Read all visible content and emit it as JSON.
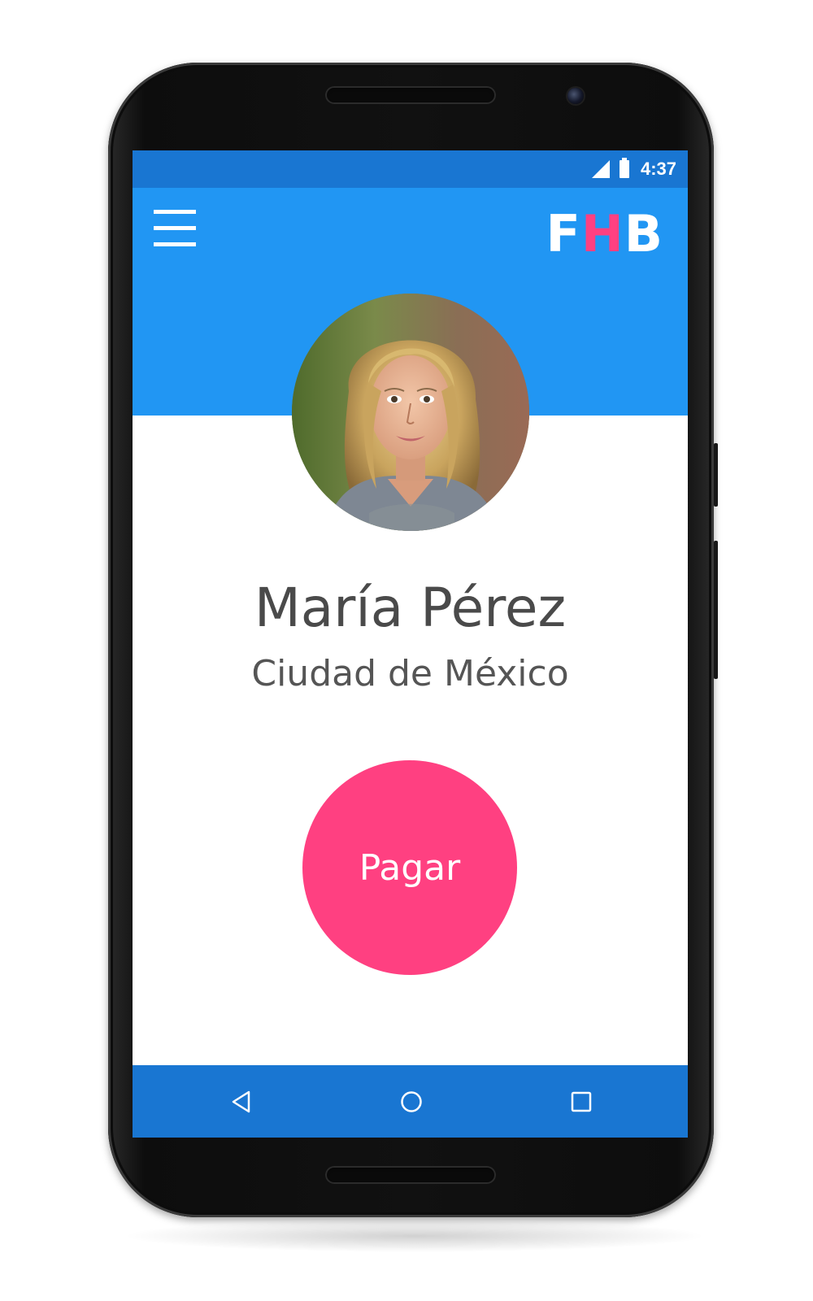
{
  "status_bar": {
    "time": "4:37",
    "icons": [
      "signal-icon",
      "battery-icon"
    ]
  },
  "app_bar": {
    "logo": {
      "f": "F",
      "h": "H",
      "b": "B"
    },
    "menu_icon": "hamburger-menu-icon"
  },
  "profile": {
    "name": "María Pérez",
    "city": "Ciudad de México"
  },
  "actions": {
    "pay_label": "Pagar"
  },
  "nav_bar": {
    "icons": [
      "back-icon",
      "home-icon",
      "recent-apps-icon"
    ]
  },
  "colors": {
    "primary": "#2196F3",
    "primary_dark": "#1976D2",
    "accent": "#FF4081",
    "text": "#4a4a4a"
  }
}
